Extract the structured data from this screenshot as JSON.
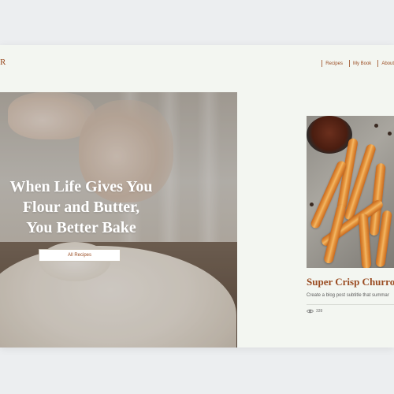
{
  "header": {
    "logo_text": "R",
    "nav": [
      {
        "label": "Recipes"
      },
      {
        "label": "My Book"
      },
      {
        "label": "About"
      }
    ]
  },
  "hero": {
    "title_lines": [
      "When Life Gives You",
      "Flour and Butter,",
      "You Better Bake"
    ],
    "button_label": "All Recipes"
  },
  "post": {
    "title": "Super Crisp Churros",
    "subtitle": "Create a blog post subtitle that summar",
    "views": "339"
  },
  "colors": {
    "accent": "#9a4c22",
    "page_bg": "#f3f6f1",
    "outer_bg": "#eceef0"
  },
  "icons": [
    "eye-icon"
  ]
}
